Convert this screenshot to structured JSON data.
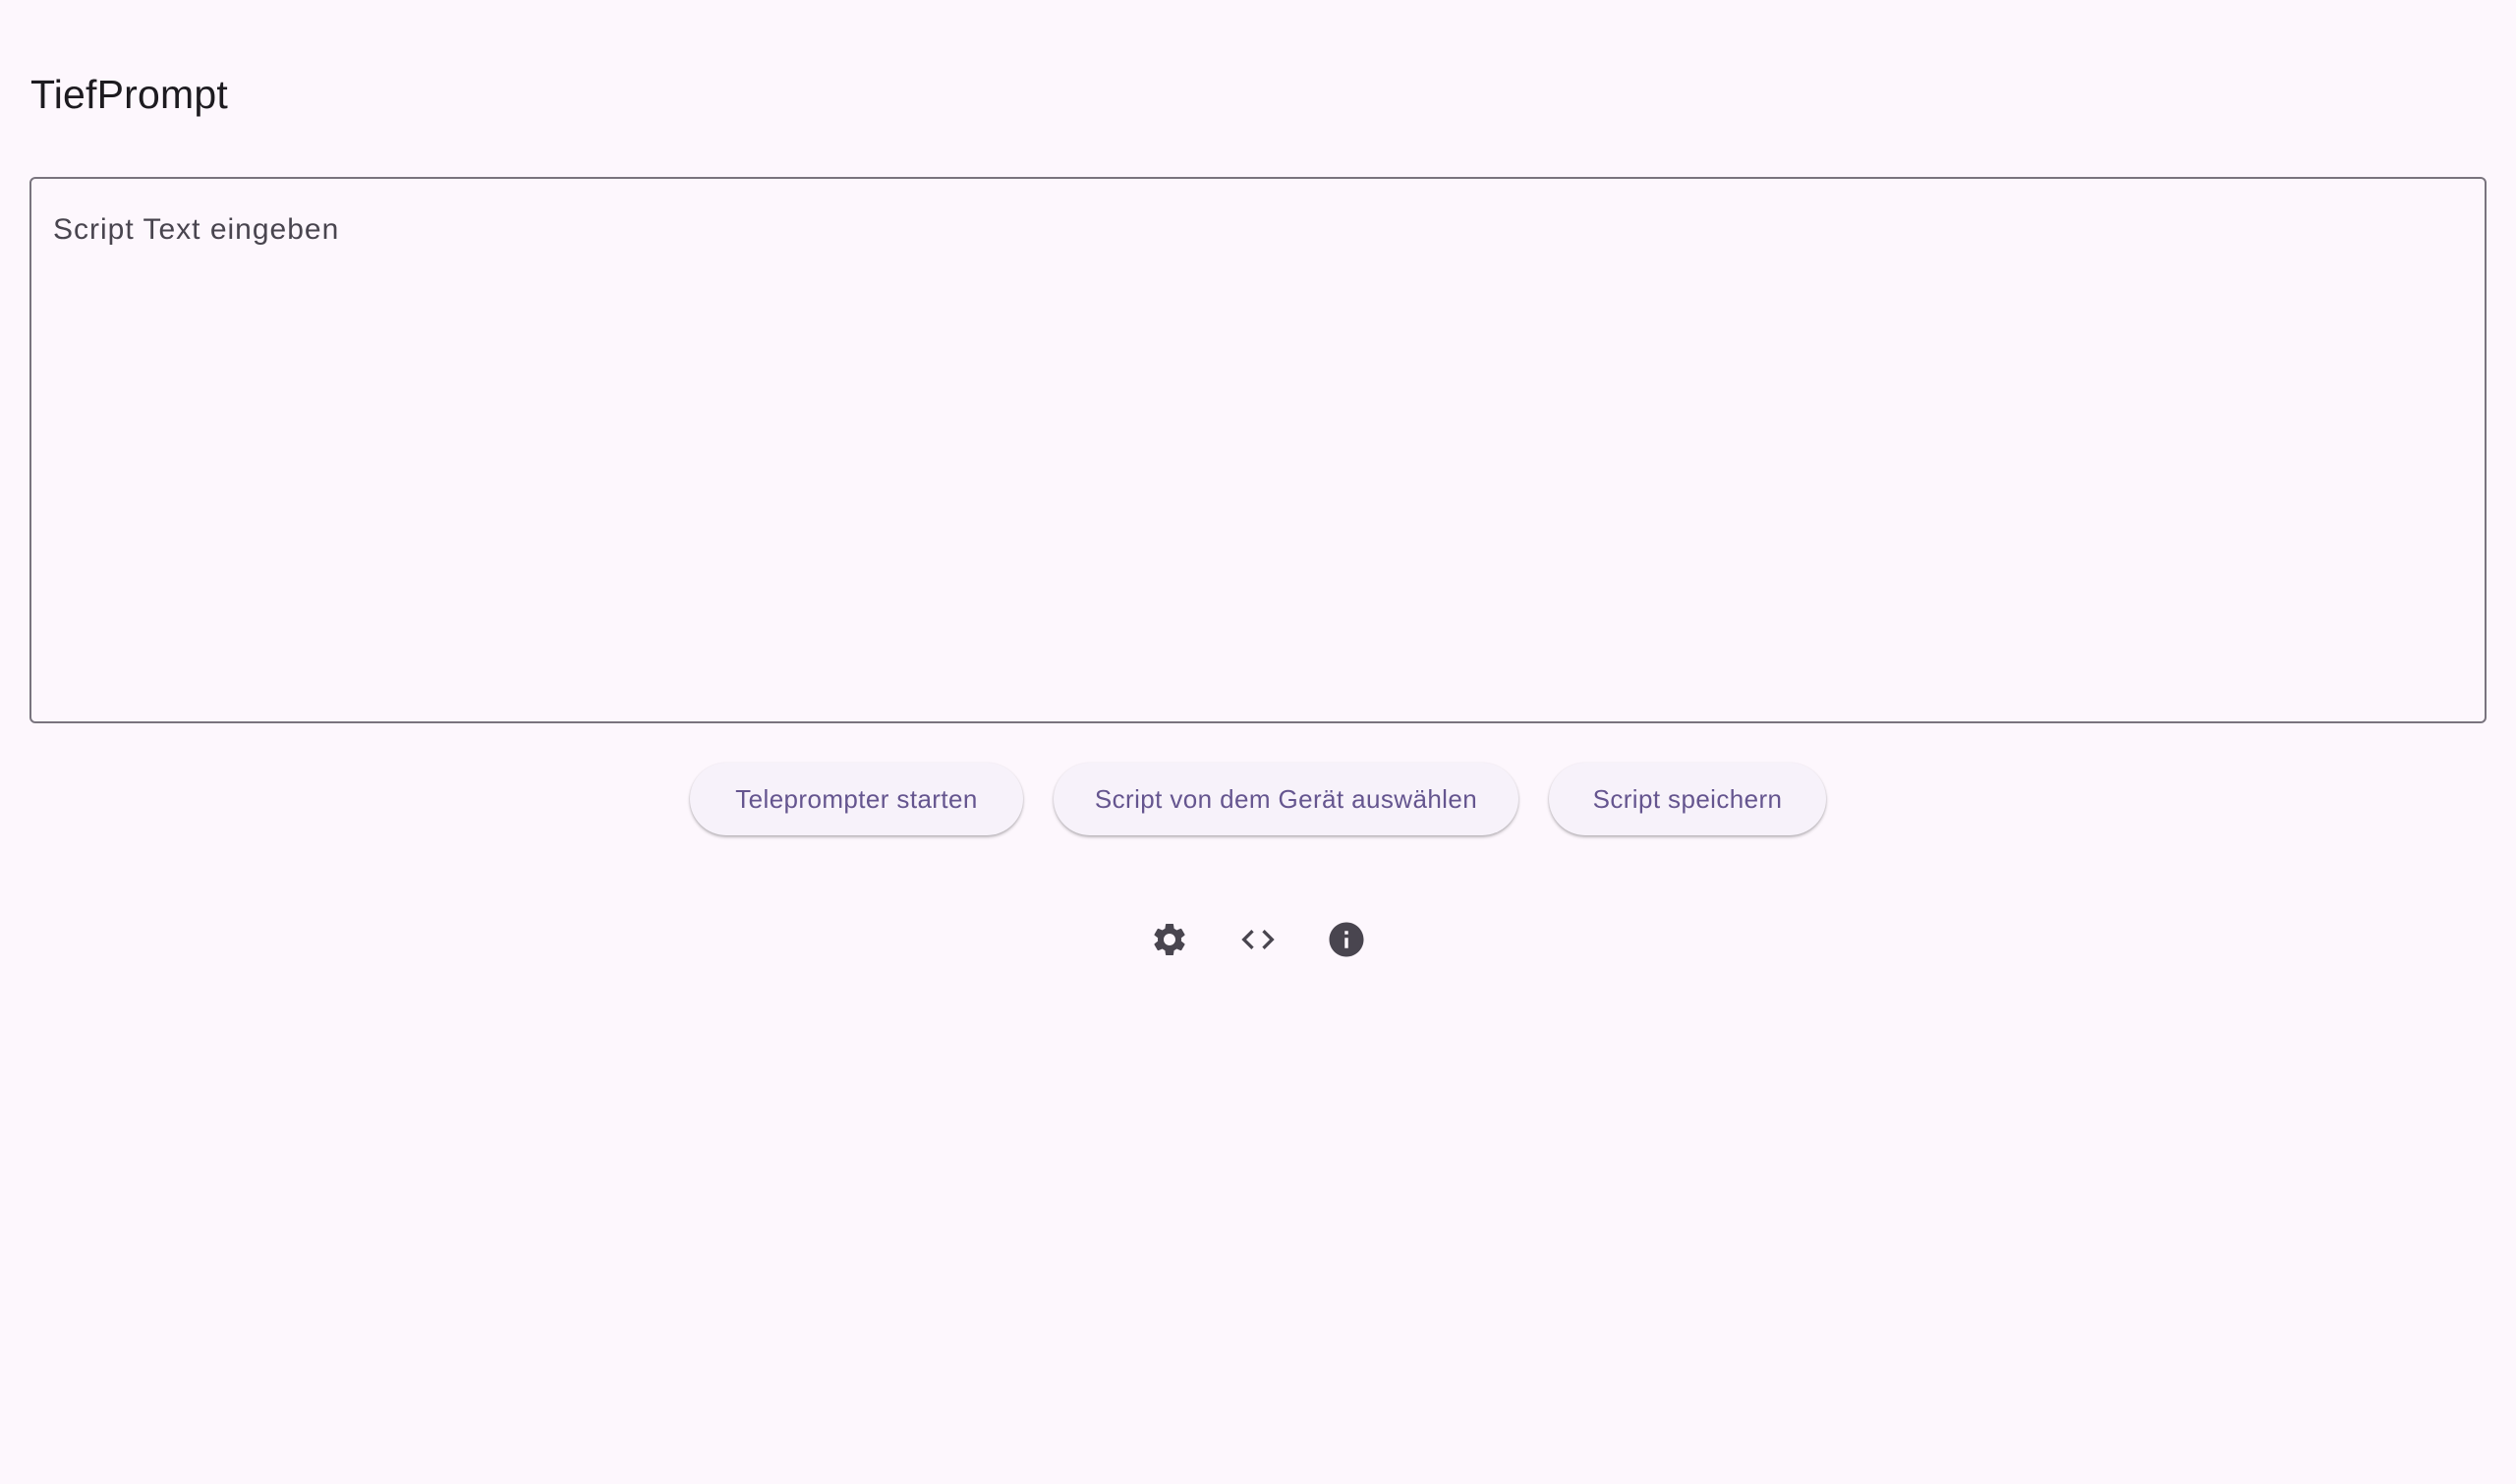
{
  "app": {
    "title": "TiefPrompt"
  },
  "editor": {
    "placeholder": "Script Text eingeben",
    "value": ""
  },
  "actions": {
    "start_label": "Teleprompter starten",
    "load_label": "Script von dem Gerät auswählen",
    "save_label": "Script speichern"
  },
  "icons": {
    "settings": "gear-icon",
    "code": "code-icon",
    "info": "info-icon"
  },
  "colors": {
    "background": "#fdf7fd",
    "button_background": "#f7f2fa",
    "button_text": "#65558f",
    "icon": "#49454f",
    "outline": "#79747e"
  }
}
